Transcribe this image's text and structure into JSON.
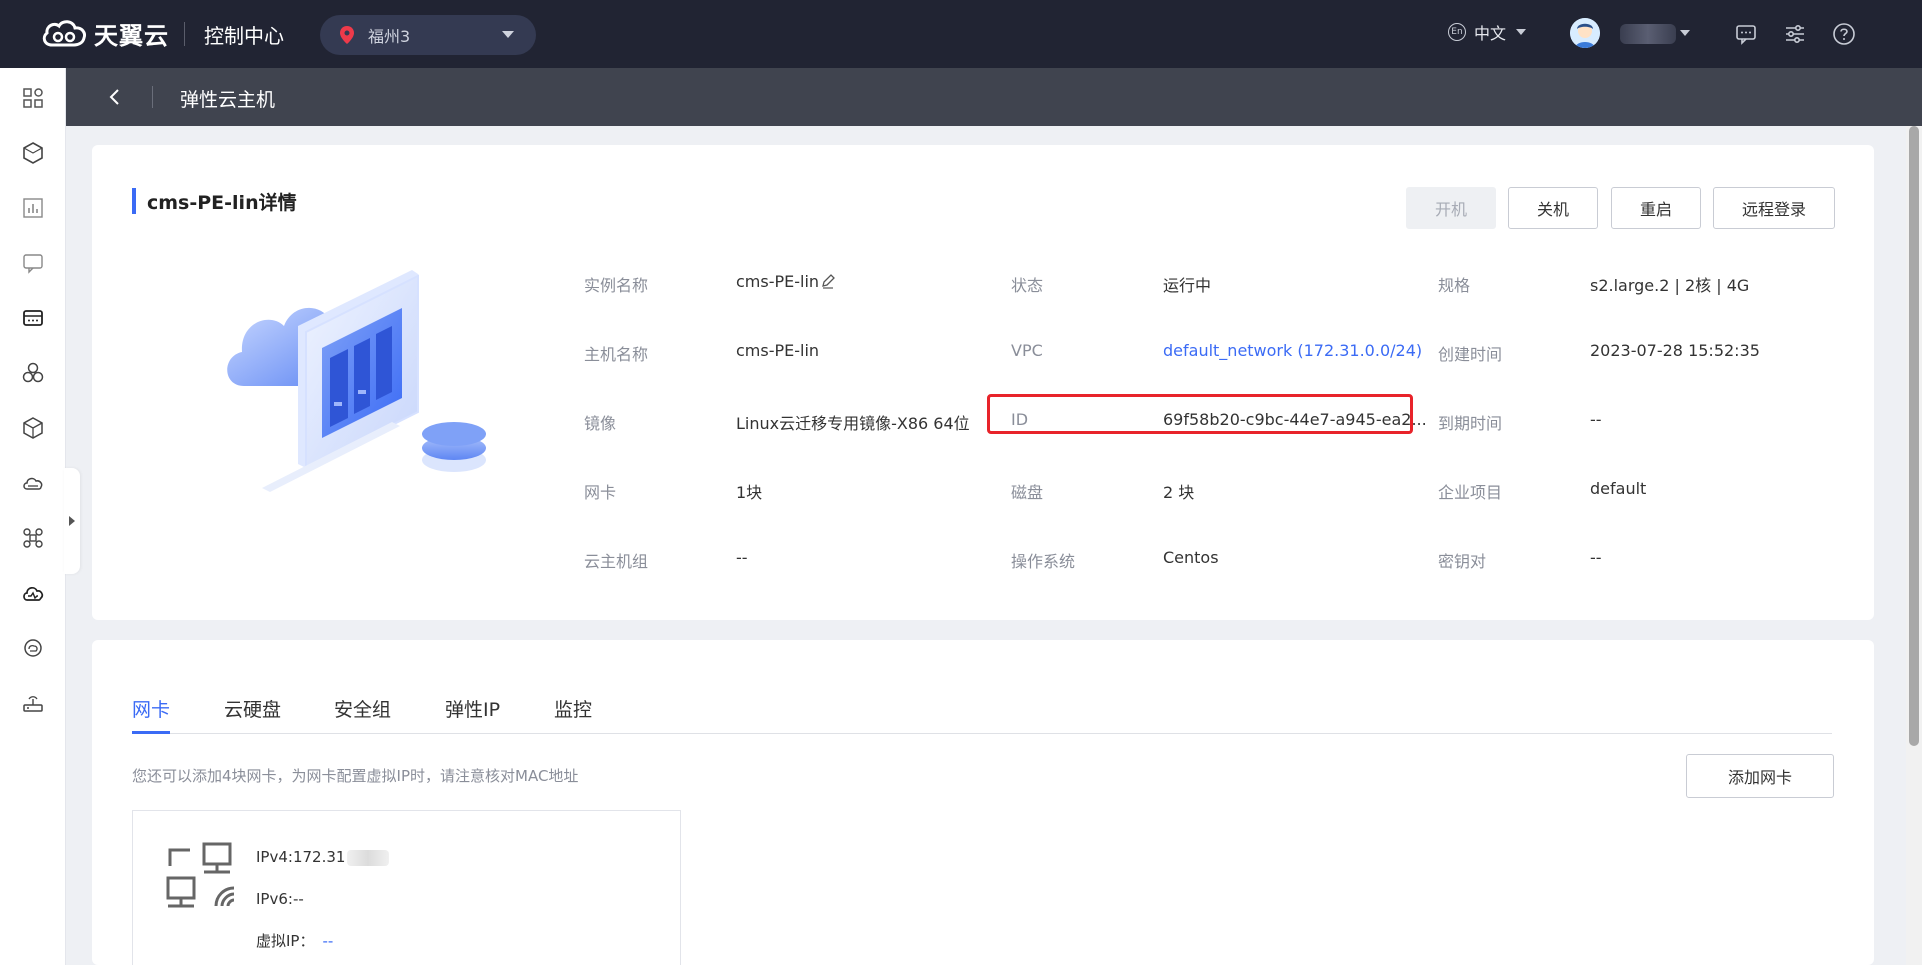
{
  "topbar": {
    "brand": "天翼云",
    "console_title": "控制中心",
    "region": "福州3",
    "language": "中文",
    "language_badge": "En"
  },
  "subheader": {
    "title": "弹性云主机"
  },
  "detail": {
    "title": "cms-PE-lin详情",
    "actions": {
      "power_on": "开机",
      "power_off": "关机",
      "restart": "重启",
      "remote_login": "远程登录"
    },
    "fields": {
      "instance_name_label": "实例名称",
      "instance_name_value": "cms-PE-lin",
      "host_name_label": "主机名称",
      "host_name_value": "cms-PE-lin",
      "image_label": "镜像",
      "image_value": "Linux云迁移专用镜像-X86 64位",
      "nic_label": "网卡",
      "nic_value": "1块",
      "group_label": "云主机组",
      "group_value": "--",
      "status_label": "状态",
      "status_value": "运行中",
      "vpc_label": "VPC",
      "vpc_value": "default_network (172.31.0.0/24)",
      "id_label": "ID",
      "id_value": "69f58b20-c9bc-44e7-a945-ea2...",
      "disk_label": "磁盘",
      "disk_value": "2 块",
      "os_label": "操作系统",
      "os_value": "Centos",
      "spec_label": "规格",
      "spec_value": "s2.large.2 | 2核 | 4G",
      "created_label": "创建时间",
      "created_value": "2023-07-28 15:52:35",
      "expire_label": "到期时间",
      "expire_value": "--",
      "project_label": "企业项目",
      "project_value": "default",
      "keypair_label": "密钥对",
      "keypair_value": "--"
    }
  },
  "tabs": {
    "items": [
      "网卡",
      "云硬盘",
      "安全组",
      "弹性IP",
      "监控"
    ],
    "active": "网卡",
    "hint": "您还可以添加4块网卡，为网卡配置虚拟IP时，请注意核对MAC地址",
    "add_button": "添加网卡"
  },
  "nic": {
    "ipv4": "IPv4:172.31",
    "ipv6": "IPv6:--",
    "virtual_ip_label": "虚拟IP：",
    "virtual_ip_value": "--"
  },
  "colors": {
    "topbar": "#212433",
    "subheader": "#40444f",
    "accent": "#3b6bf5",
    "highlight": "#e8232a"
  },
  "icons": {
    "nav": [
      "grid-icon",
      "hexagon-icon",
      "chart-icon",
      "chat-icon",
      "server-icon",
      "cluster-icon",
      "cube-icon",
      "cloud-storage-icon",
      "network-icon",
      "cloud-monitor-icon",
      "cloud-sync-icon",
      "router-icon"
    ],
    "top": [
      "message-icon",
      "settings-sliders-icon",
      "help-icon"
    ]
  }
}
